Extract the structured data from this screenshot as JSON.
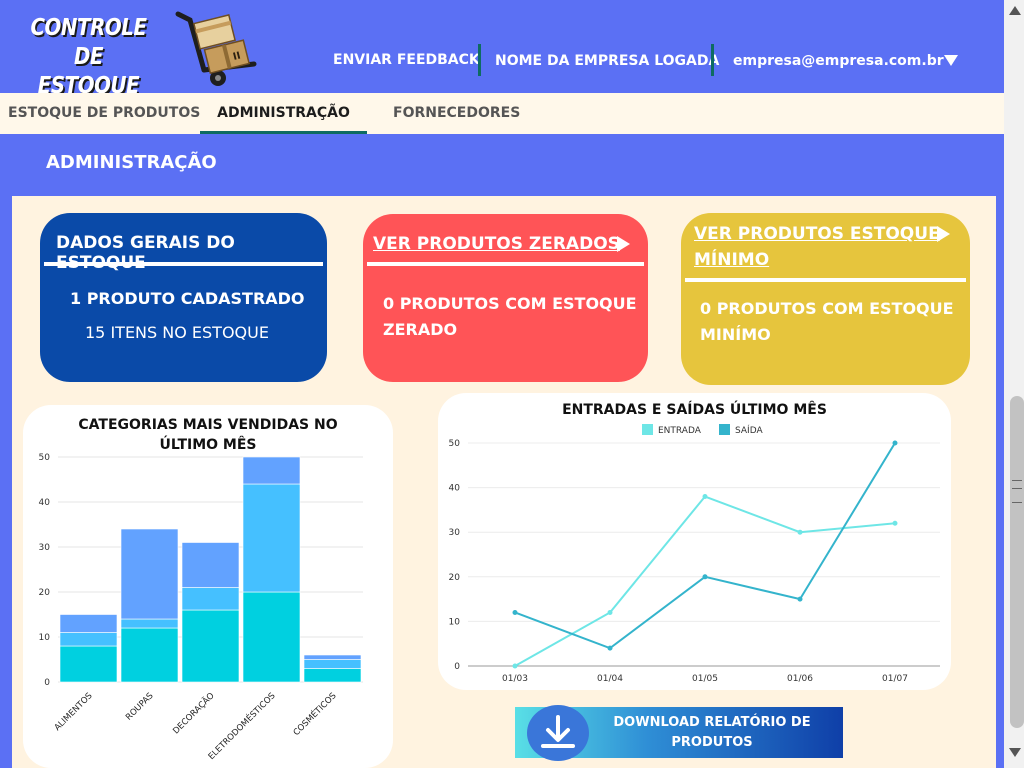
{
  "header": {
    "logo_line1": "CONTROLE DE",
    "logo_line2": "ESTOQUE",
    "feedback": "ENVIAR FEEDBACK",
    "company": "NOME DA EMPRESA LOGADA",
    "email": "empresa@empresa.com.br"
  },
  "tabs": [
    {
      "label": "ESTOQUE DE PRODUTOS",
      "active": false
    },
    {
      "label": "ADMINISTRAÇÃO",
      "active": true
    },
    {
      "label": "FORNECEDORES",
      "active": false
    }
  ],
  "section_title": "ADMINISTRAÇÃO",
  "cards": {
    "general": {
      "title": "DADOS GERAIS DO ESTOQUE",
      "line1": "1 PRODUTO CADASTRADO",
      "line2": "15 ITENS NO ESTOQUE",
      "color": "#0a4aa8"
    },
    "zero": {
      "title": "VER PRODUTOS ZERADOS",
      "line1": "0 PRODUTOS COM ESTOQUE",
      "line2": "ZERADO",
      "color": "#ff5457"
    },
    "minimum": {
      "title_line1": "VER PRODUTOS ESTOQUE",
      "title_line2": "MÍNIMO",
      "line1": "0 PRODUTOS COM ESTOQUE",
      "line2": "MINÍMO",
      "color": "#e6c53d"
    }
  },
  "download": {
    "line1": "DOWNLOAD RELATÓRIO DE",
    "line2": "PRODUTOS"
  },
  "chart_data": [
    {
      "type": "bar",
      "stacked": true,
      "title": "CATEGORIAS MAIS VENDIDAS NO ÚLTIMO MÊS",
      "title_line1": "CATEGORIAS MAIS VENDIDAS NO",
      "title_line2": "ÚLTIMO MÊS",
      "categories": [
        "ALIMENTOS",
        "ROUPAS",
        "DECORAÇÃO",
        "ELETRODOMÉSTICOS",
        "COSMÉTICOS"
      ],
      "series": [
        {
          "values": [
            8,
            12,
            16,
            20,
            3
          ],
          "color": "#00d0e0"
        },
        {
          "values": [
            3,
            2,
            5,
            24,
            2
          ],
          "color": "#45c0ff"
        },
        {
          "values": [
            4,
            20,
            10,
            6,
            1
          ],
          "color": "#62a2ff"
        }
      ],
      "ylim": [
        0,
        50
      ],
      "yticks": [
        0,
        10,
        20,
        30,
        40,
        50
      ],
      "grid": true
    },
    {
      "type": "line",
      "title": "ENTRADAS E SAÍDAS ÚLTIMO MÊS",
      "categories": [
        "01/03",
        "01/04",
        "01/05",
        "01/06",
        "01/07"
      ],
      "series": [
        {
          "name": "ENTRADA",
          "values": [
            0,
            12,
            38,
            30,
            32
          ],
          "color": "#6ee6e6"
        },
        {
          "name": "SAÍDA",
          "values": [
            12,
            4,
            20,
            15,
            50
          ],
          "color": "#34b4cc"
        }
      ],
      "ylim": [
        0,
        50
      ],
      "yticks": [
        0,
        10,
        20,
        30,
        40,
        50
      ],
      "legend": "top",
      "grid": true
    }
  ]
}
